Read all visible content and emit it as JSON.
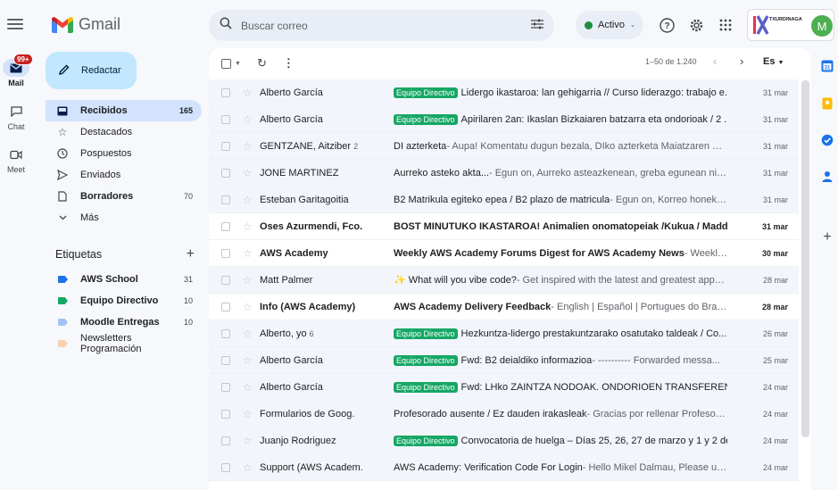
{
  "app": {
    "name": "Gmail"
  },
  "rail": {
    "items": [
      {
        "label": "Mail",
        "badge": "99+"
      },
      {
        "label": "Chat"
      },
      {
        "label": "Meet"
      }
    ]
  },
  "compose_label": "Redactar",
  "nav": [
    {
      "label": "Recibidos",
      "count": "165",
      "icon": "inbox-icon"
    },
    {
      "label": "Destacados",
      "count": "",
      "icon": "star-icon"
    },
    {
      "label": "Pospuestos",
      "count": "",
      "icon": "clock-icon"
    },
    {
      "label": "Enviados",
      "count": "",
      "icon": "send-icon"
    },
    {
      "label": "Borradores",
      "count": "70",
      "icon": "draft-icon"
    },
    {
      "label": "Más",
      "count": "",
      "icon": "chevron-down-icon"
    }
  ],
  "labels_title": "Etiquetas",
  "labels": [
    {
      "label": "AWS School",
      "count": "31",
      "color": "#1a73e8"
    },
    {
      "label": "Equipo Directivo",
      "count": "10",
      "color": "#16a765"
    },
    {
      "label": "Moodle Entregas",
      "count": "10",
      "color": "#a4c2f4"
    },
    {
      "label": "Newsletters Programación",
      "count": "",
      "color": "#fad1b0"
    }
  ],
  "search": {
    "placeholder": "Buscar correo"
  },
  "status_label": "Activo",
  "org_logo_text": "TXURDINAGA",
  "avatar_letter": "M",
  "toolbar": {
    "range": "1–50 de 1.240",
    "lang": "Es"
  },
  "emails": [
    {
      "sender": "Alberto García",
      "count": "",
      "chip": "Equipo Directivo",
      "subject": "Lidergo ikastaroa: lan gehigarria // Curso liderazgo: trabajo e...",
      "snippet": "",
      "date": "31 mar",
      "unread": false
    },
    {
      "sender": "Alberto García",
      "count": "",
      "chip": "Equipo Directivo",
      "subject": "Apirilaren 2an: Ikaslan Bizkaiaren batzarra eta ondorioak / 2 ...",
      "snippet": "",
      "date": "31 mar",
      "unread": false
    },
    {
      "sender": "GENTZANE, Aitziber",
      "count": "2",
      "chip": "",
      "subject": "DI azterketa",
      "snippet": " - Aupa! Komentatu dugun bezala, DIko azterketa Maiatzaren 8a...",
      "date": "31 mar",
      "unread": false
    },
    {
      "sender": "JONE MARTINEZ",
      "count": "",
      "chip": "",
      "subject": "Aurreko asteko akta...",
      "snippet": " - Egun on, Aurreko asteazkenean, greba egunean nire ...",
      "date": "31 mar",
      "unread": false
    },
    {
      "sender": "Esteban Garitagoitia",
      "count": "",
      "chip": "",
      "subject": "B2 Matrikula egiteko epea / B2 plazo de matricula",
      "snippet": " - Egun on, Korreo honekin ...",
      "date": "31 mar",
      "unread": false
    },
    {
      "sender": "Oses Azurmendi, Fco.",
      "count": "",
      "chip": "",
      "subject": "BOST MINUTUKO IKASTAROA! Animalien onomatopeiak /Kukua / Maddi...",
      "snippet": "",
      "date": "31 mar",
      "unread": true
    },
    {
      "sender": "AWS Academy",
      "count": "",
      "chip": "",
      "subject": "Weekly AWS Academy Forums Digest for AWS Academy News",
      "snippet": " - Weekly ...",
      "date": "30 mar",
      "unread": true
    },
    {
      "sender": "Matt Palmer",
      "count": "",
      "chip": "",
      "subject": "✨ What will you vibe code?",
      "snippet": " - Get inspired with the latest and greatest apps,...",
      "date": "28 mar",
      "unread": false
    },
    {
      "sender": "Info (AWS Academy)",
      "count": "",
      "chip": "",
      "subject": "AWS Academy Delivery Feedback",
      "snippet": " - English | Español | Portugues do Brasil...",
      "date": "28 mar",
      "unread": true
    },
    {
      "sender": "Alberto, yo",
      "count": "6",
      "chip": "Equipo Directivo",
      "subject": "Hezkuntza-lidergo prestakuntzarako osatutako taldeak / Co...",
      "snippet": "",
      "date": "26 mar",
      "unread": false
    },
    {
      "sender": "Alberto García",
      "count": "",
      "chip": "Equipo Directivo",
      "subject": "Fwd: B2 deialdiko informazioa",
      "snippet": " - ---------- Forwarded messa...",
      "date": "25 mar",
      "unread": false
    },
    {
      "sender": "Alberto García",
      "count": "",
      "chip": "Equipo Directivo",
      "subject": "Fwd: LHko ZAINTZA NODOAK. ONDORIOEN TRANSFERENTZ...",
      "snippet": "",
      "date": "24 mar",
      "unread": false
    },
    {
      "sender": "Formularios de Goog.",
      "count": "",
      "chip": "",
      "subject": "Profesorado ausente / Ez dauden irakasleak",
      "snippet": " - Gracias por rellenar Profesora...",
      "date": "24 mar",
      "unread": false
    },
    {
      "sender": "Juanjo Rodriguez",
      "count": "",
      "chip": "Equipo Directivo",
      "subject": "Convocatoria de huelga – Días 25, 26, 27 de marzo y 1 y 2 de...",
      "snippet": "",
      "date": "24 mar",
      "unread": false
    },
    {
      "sender": "Support (AWS Academ.",
      "count": "",
      "chip": "",
      "subject": "AWS Academy: Verification Code For Login",
      "snippet": " - Hello Mikel Dalmau, Please use ...",
      "date": "24 mar",
      "unread": false
    }
  ]
}
